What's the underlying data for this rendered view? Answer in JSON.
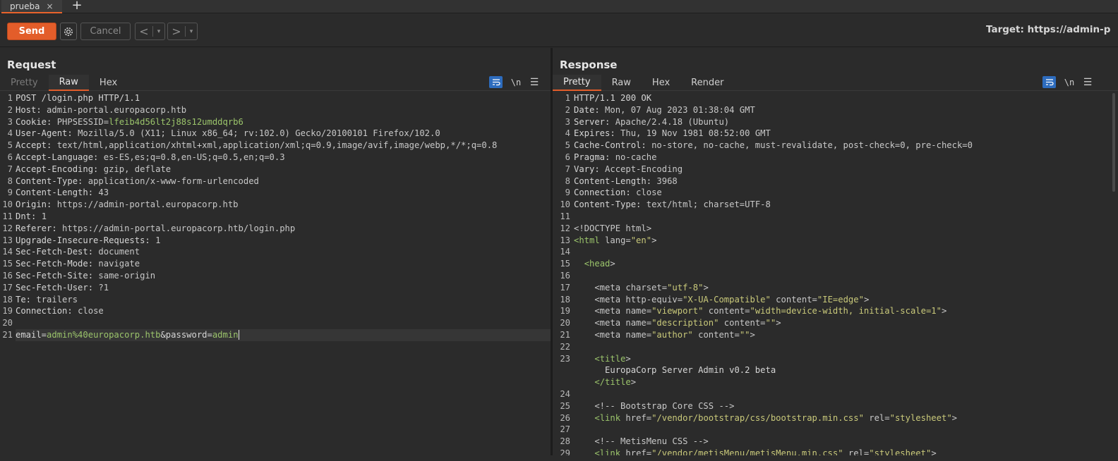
{
  "tabs": [
    {
      "label": "prueba",
      "close": "×"
    }
  ],
  "tab_add": "+",
  "toolbar": {
    "send": "Send",
    "cancel": "Cancel",
    "back": "<",
    "forward": ">",
    "dropdown": "▾",
    "target_label": "Target: ",
    "target_value": "https://admin-p"
  },
  "request": {
    "title": "Request",
    "tabs": [
      "Pretty",
      "Raw",
      "Hex"
    ],
    "active_tab": "Raw",
    "newline_toggle": "\\n",
    "lines": [
      {
        "n": "1",
        "k": "POST /login.php HTTP/1.1",
        "v": ""
      },
      {
        "n": "2",
        "k": "Host: ",
        "v": "admin-portal.europacorp.htb"
      },
      {
        "n": "3",
        "k": "Cookie: ",
        "v": "PHPSESSID=",
        "g": "lfeib4d56lt2j88s12umddqrb6"
      },
      {
        "n": "4",
        "k": "User-Agent: ",
        "v": "Mozilla/5.0 (X11; Linux x86_64; rv:102.0) Gecko/20100101 Firefox/102.0"
      },
      {
        "n": "5",
        "k": "Accept: ",
        "v": "text/html,application/xhtml+xml,application/xml;q=0.9,image/avif,image/webp,*/*;q=0.8"
      },
      {
        "n": "6",
        "k": "Accept-Language: ",
        "v": "es-ES,es;q=0.8,en-US;q=0.5,en;q=0.3"
      },
      {
        "n": "7",
        "k": "Accept-Encoding: ",
        "v": "gzip, deflate"
      },
      {
        "n": "8",
        "k": "Content-Type: ",
        "v": "application/x-www-form-urlencoded"
      },
      {
        "n": "9",
        "k": "Content-Length: ",
        "v": "43"
      },
      {
        "n": "10",
        "k": "Origin: ",
        "v": "https://admin-portal.europacorp.htb"
      },
      {
        "n": "11",
        "k": "Dnt: ",
        "v": "1"
      },
      {
        "n": "12",
        "k": "Referer: ",
        "v": "https://admin-portal.europacorp.htb/login.php"
      },
      {
        "n": "13",
        "k": "Upgrade-Insecure-Requests: ",
        "v": "1"
      },
      {
        "n": "14",
        "k": "Sec-Fetch-Dest: ",
        "v": "document"
      },
      {
        "n": "15",
        "k": "Sec-Fetch-Mode: ",
        "v": "navigate"
      },
      {
        "n": "16",
        "k": "Sec-Fetch-Site: ",
        "v": "same-origin"
      },
      {
        "n": "17",
        "k": "Sec-Fetch-User: ",
        "v": "?1"
      },
      {
        "n": "18",
        "k": "Te: ",
        "v": "trailers"
      },
      {
        "n": "19",
        "k": "Connection: ",
        "v": "close"
      },
      {
        "n": "20",
        "k": "",
        "v": ""
      }
    ],
    "body_line": {
      "n": "21",
      "p1": "email=",
      "v1": "admin%40europacorp.htb",
      "p2": "&password=",
      "v2": "admin"
    }
  },
  "response": {
    "title": "Response",
    "tabs": [
      "Pretty",
      "Raw",
      "Hex",
      "Render"
    ],
    "active_tab": "Pretty",
    "newline_toggle": "\\n",
    "headers": [
      {
        "n": "1",
        "k": "HTTP/1.1 200 OK",
        "v": ""
      },
      {
        "n": "2",
        "k": "Date: ",
        "v": "Mon, 07 Aug 2023 01:38:04 GMT"
      },
      {
        "n": "3",
        "k": "Server: ",
        "v": "Apache/2.4.18 (Ubuntu)"
      },
      {
        "n": "4",
        "k": "Expires: ",
        "v": "Thu, 19 Nov 1981 08:52:00 GMT"
      },
      {
        "n": "5",
        "k": "Cache-Control: ",
        "v": "no-store, no-cache, must-revalidate, post-check=0, pre-check=0"
      },
      {
        "n": "6",
        "k": "Pragma: ",
        "v": "no-cache"
      },
      {
        "n": "7",
        "k": "Vary: ",
        "v": "Accept-Encoding"
      },
      {
        "n": "8",
        "k": "Content-Length: ",
        "v": "3968"
      },
      {
        "n": "9",
        "k": "Connection: ",
        "v": "close"
      },
      {
        "n": "10",
        "k": "Content-Type: ",
        "v": "text/html; charset=UTF-8"
      },
      {
        "n": "11",
        "k": "",
        "v": ""
      }
    ],
    "html_lines": [
      {
        "n": "12",
        "parts": [
          [
            "v",
            "<!DOCTYPE html>"
          ]
        ]
      },
      {
        "n": "13",
        "parts": [
          [
            "g",
            "<html "
          ],
          [
            "v",
            "lang="
          ],
          [
            "s",
            "\"en\""
          ],
          [
            "v",
            ">"
          ]
        ]
      },
      {
        "n": "14",
        "parts": []
      },
      {
        "n": "15",
        "parts": [
          [
            "v",
            "  "
          ],
          [
            "g",
            "<head"
          ],
          [
            "v",
            ">"
          ]
        ]
      },
      {
        "n": "16",
        "parts": []
      },
      {
        "n": "17",
        "parts": [
          [
            "v",
            "    <meta "
          ],
          [
            "v",
            "charset="
          ],
          [
            "s",
            "\"utf-8\""
          ],
          [
            "v",
            ">"
          ]
        ]
      },
      {
        "n": "18",
        "parts": [
          [
            "v",
            "    <meta "
          ],
          [
            "v",
            "http-equiv="
          ],
          [
            "s",
            "\"X-UA-Compatible\""
          ],
          [
            "v",
            " content="
          ],
          [
            "s",
            "\"IE=edge\""
          ],
          [
            "v",
            ">"
          ]
        ]
      },
      {
        "n": "19",
        "parts": [
          [
            "v",
            "    <meta "
          ],
          [
            "v",
            "name="
          ],
          [
            "s",
            "\"viewport\""
          ],
          [
            "v",
            " content="
          ],
          [
            "s",
            "\"width=device-width, initial-scale=1\""
          ],
          [
            "v",
            ">"
          ]
        ]
      },
      {
        "n": "20",
        "parts": [
          [
            "v",
            "    <meta "
          ],
          [
            "v",
            "name="
          ],
          [
            "s",
            "\"description\""
          ],
          [
            "v",
            " content="
          ],
          [
            "s",
            "\"\""
          ],
          [
            "v",
            ">"
          ]
        ]
      },
      {
        "n": "21",
        "parts": [
          [
            "v",
            "    <meta "
          ],
          [
            "v",
            "name="
          ],
          [
            "s",
            "\"author\""
          ],
          [
            "v",
            " content="
          ],
          [
            "s",
            "\"\""
          ],
          [
            "v",
            ">"
          ]
        ]
      },
      {
        "n": "22",
        "parts": []
      },
      {
        "n": "23",
        "parts": [
          [
            "v",
            "    "
          ],
          [
            "g",
            "<title"
          ],
          [
            "v",
            ">"
          ]
        ],
        "cont": "      EuropaCorp Server Admin v0.2 beta"
      },
      {
        "n": "",
        "parts": [
          [
            "v",
            "    "
          ],
          [
            "g",
            "</title"
          ],
          [
            "v",
            ">"
          ]
        ]
      },
      {
        "n": "24",
        "parts": []
      },
      {
        "n": "25",
        "parts": [
          [
            "v",
            "    <!-- Bootstrap Core CSS -->"
          ]
        ]
      },
      {
        "n": "26",
        "parts": [
          [
            "v",
            "    "
          ],
          [
            "g",
            "<link "
          ],
          [
            "v",
            "href="
          ],
          [
            "s",
            "\"/vendor/bootstrap/css/bootstrap.min.css\""
          ],
          [
            "v",
            " rel="
          ],
          [
            "s",
            "\"stylesheet\""
          ],
          [
            "v",
            ">"
          ]
        ]
      },
      {
        "n": "27",
        "parts": []
      },
      {
        "n": "28",
        "parts": [
          [
            "v",
            "    <!-- MetisMenu CSS -->"
          ]
        ]
      },
      {
        "n": "29",
        "parts": [
          [
            "v",
            "    "
          ],
          [
            "g",
            "<link "
          ],
          [
            "v",
            "href="
          ],
          [
            "s",
            "\"/vendor/metisMenu/metisMenu.min.css\""
          ],
          [
            "v",
            " rel="
          ],
          [
            "s",
            "\"stylesheet\""
          ],
          [
            "v",
            ">"
          ]
        ]
      }
    ]
  },
  "colors": {
    "accent": "#e35d2a",
    "blue": "#2d6cbe",
    "green": "#9bc46b",
    "string": "#c9c97a"
  }
}
